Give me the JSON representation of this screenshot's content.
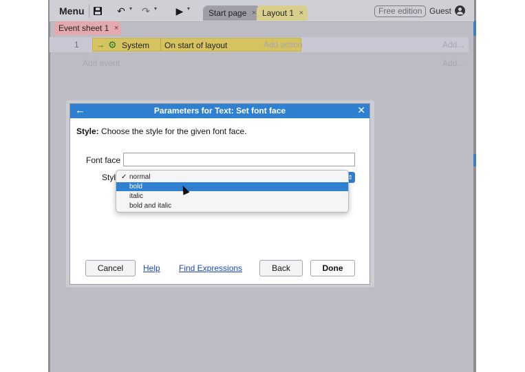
{
  "toolbar": {
    "menu_label": "Menu",
    "tabs": [
      {
        "label": "Start page",
        "close": "×"
      },
      {
        "label": "Layout 1",
        "close": "×"
      }
    ],
    "edition_label": "Free edition",
    "user_label": "Guest"
  },
  "event_sheet": {
    "tab_label": "Event sheet 1",
    "tab_close": "×",
    "row_number": "1",
    "condition_object": "System",
    "condition_text": "On start of layout",
    "add_action": "Add action",
    "add_right_1": "Add...",
    "add_right_2": "Add...",
    "add_event": "Add event"
  },
  "dialog": {
    "title": "Parameters for Text: Set font face",
    "back_glyph": "←",
    "close_glyph": "✕",
    "desc_bold": "Style:",
    "desc_text": " Choose the style for the given font face.",
    "font_face_label": "Font face",
    "font_face_value": "",
    "style_label": "Style",
    "buttons": {
      "cancel": "Cancel",
      "help": "Help",
      "find_expressions": "Find Expressions",
      "back": "Back",
      "done": "Done"
    }
  },
  "dropdown": {
    "options": [
      "normal",
      "bold",
      "italic",
      "bold and italic"
    ],
    "checked": "normal",
    "highlighted": "bold"
  },
  "colors": {
    "accent": "#2f80d1",
    "condition": "#d4c35e",
    "tab_layout": "#d8cf8c",
    "tab_sheet": "#e4a9ae"
  }
}
